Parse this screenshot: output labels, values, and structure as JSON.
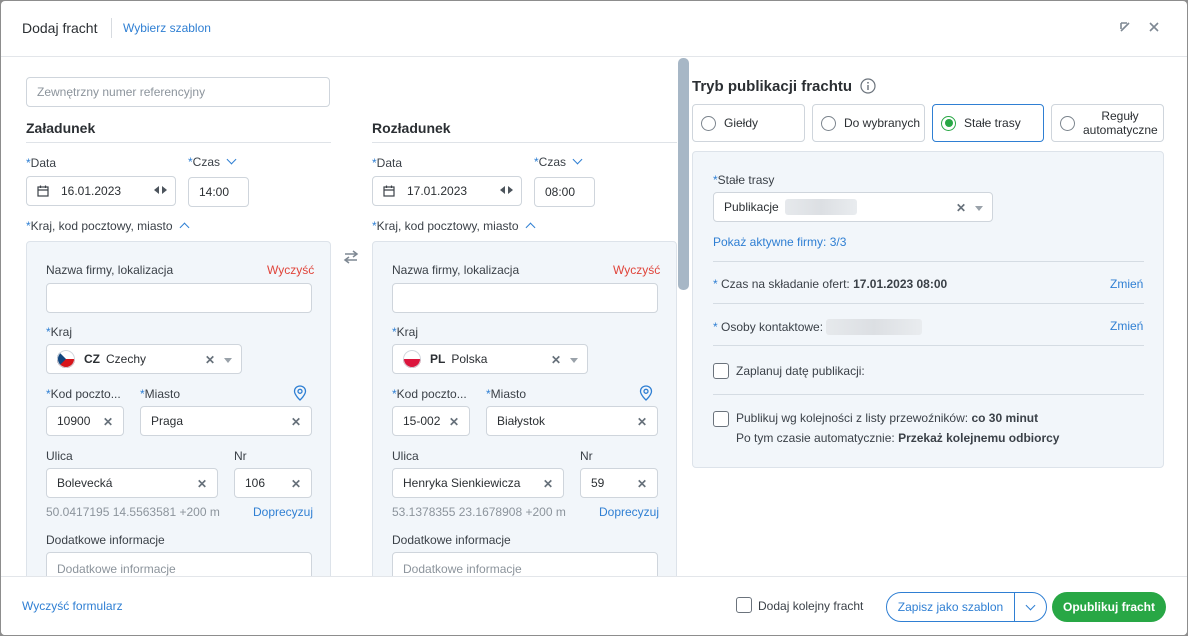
{
  "header": {
    "title": "Dodaj fracht",
    "template_link": "Wybierz szablon"
  },
  "reference": {
    "placeholder": "Zewnętrzny numer referencyjny"
  },
  "common": {
    "date_label": "Data",
    "time_label": "Czas",
    "location_label": "Kraj, kod pocztowy, miasto",
    "company_label": "Nazwa firmy, lokalizacja",
    "clear_label": "Wyczyść",
    "country_label": "Kraj",
    "postal_label": "Kod poczto...",
    "city_label": "Miasto",
    "street_label": "Ulica",
    "nr_label": "Nr",
    "refine_link": "Doprecyzuj",
    "additional_label": "Dodatkowe informacje",
    "additional_placeholder": "Dodatkowe informacje"
  },
  "loading": {
    "title": "Załadunek",
    "date": "16.01.2023",
    "time": "14:00",
    "country_code": "CZ",
    "country_name": "Czechy",
    "postal": "10900",
    "city": "Praga",
    "street": "Bolevecká",
    "nr": "106",
    "coords": "50.0417195 14.5563581 +200 m"
  },
  "unloading": {
    "title": "Rozładunek",
    "date": "17.01.2023",
    "time": "08:00",
    "country_code": "PL",
    "country_name": "Polska",
    "postal": "15-002",
    "city": "Białystok",
    "street": "Henryka Sienkiewicza",
    "nr": "59",
    "coords": "53.1378355 23.1678908 +200 m"
  },
  "publication": {
    "title": "Tryb publikacji frachtu",
    "modes": [
      "Giełdy",
      "Do wybranych",
      "Stałe trasy",
      "Reguły automatyczne"
    ],
    "selected_mode": "Stałe trasy",
    "routes_label": "Stałe trasy",
    "routes_value": "Publikacje",
    "show_firms": "Pokaż aktywne firmy: 3/3",
    "offer_time_label": "Czas na składanie ofert:",
    "offer_time_value": "17.01.2023 08:00",
    "change_label": "Zmień",
    "contacts_label": "Osoby kontaktowe:",
    "schedule_label": "Zaplanuj datę publikacji:",
    "order_label": "Publikuj wg kolejności z listy przewoźników:",
    "order_value": "co 30 minut",
    "after_label": "Po tym czasie automatycznie:",
    "after_value": "Przekaż kolejnemu odbiorcy"
  },
  "footer": {
    "clear_form": "Wyczyść formularz",
    "add_another": "Dodaj kolejny fracht",
    "save_template": "Zapisz jako szablon",
    "publish": "Opublikuj fracht"
  },
  "colors": {
    "accent": "#2f7fd3",
    "primary_button": "#28a745",
    "danger": "#e0443a",
    "panel_bg": "#f2f6fa"
  },
  "icons": [
    "collapse-icon",
    "close-icon",
    "calendar-icon",
    "swap-icon",
    "location-pin-icon",
    "info-icon",
    "chevron-down-icon"
  ]
}
